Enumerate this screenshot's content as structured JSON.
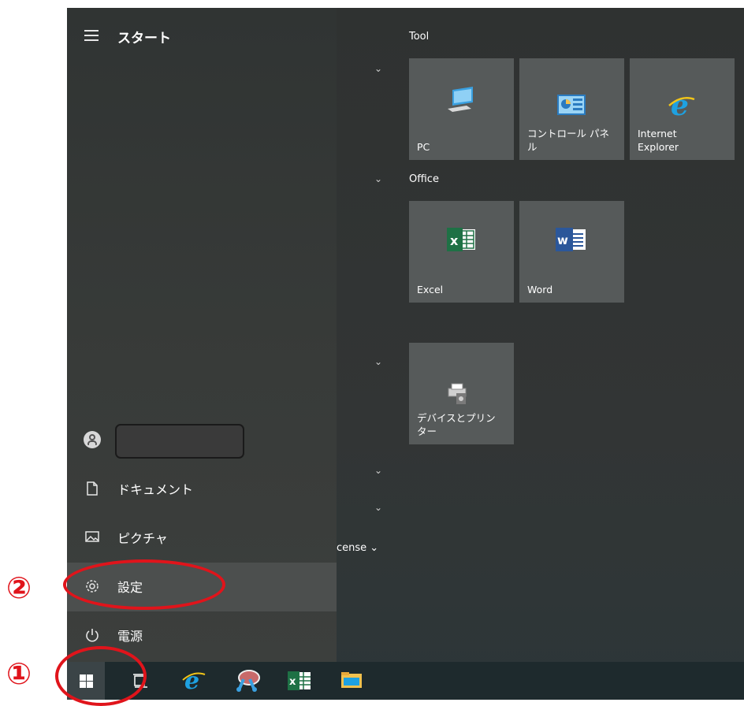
{
  "start": {
    "title": "スタート"
  },
  "user": {
    "name": ""
  },
  "nav": {
    "documents": "ドキュメント",
    "pictures": "ピクチャ",
    "settings": "設定",
    "power": "電源"
  },
  "groups": {
    "tool": "Tool",
    "office": "Office",
    "license_fragment": "cense"
  },
  "tiles": {
    "pc": "PC",
    "control_panel": "コントロール パネ\nル",
    "ie": "Internet\nExplorer",
    "excel": "Excel",
    "word": "Word",
    "devices": "デバイスとプリン\nター"
  },
  "annotations": {
    "one": "①",
    "two": "②"
  },
  "icons": [
    "hamburger-icon",
    "user-avatar-icon",
    "document-icon",
    "picture-icon",
    "gear-icon",
    "power-icon",
    "windows-logo-icon",
    "task-view-icon",
    "ie-icon",
    "snipping-icon",
    "excel-icon",
    "explorer-icon",
    "pc-icon",
    "control-panel-icon",
    "printer-icon",
    "word-icon"
  ],
  "colors": {
    "annotation": "#e0141b",
    "excel": "#1e7145",
    "word": "#2b579a",
    "ie": "#1ea1e1"
  }
}
